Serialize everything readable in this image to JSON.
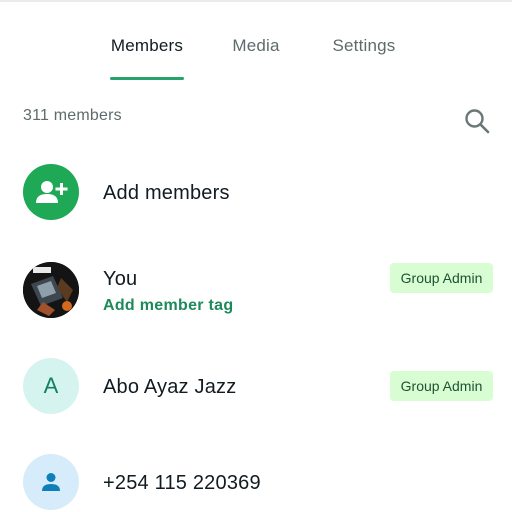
{
  "tabs": [
    {
      "label": "Members",
      "active": true
    },
    {
      "label": "Media",
      "active": false
    },
    {
      "label": "Settings",
      "active": false
    }
  ],
  "members_count": "311 members",
  "search": {
    "icon": "search-icon"
  },
  "add_members": {
    "label": "Add members",
    "icon": "person-add-icon"
  },
  "members": [
    {
      "name": "You",
      "subtitle": "Add member tag",
      "badge": "Group Admin",
      "avatar": "photo"
    },
    {
      "name": "Abo Ayaz Jazz",
      "badge": "Group Admin",
      "avatar_letter": "A"
    },
    {
      "name": "+254 115 220369",
      "avatar": "person-icon"
    }
  ],
  "colors": {
    "accent": "#25a36a",
    "add_avatar_bg": "#1fa855",
    "badge_bg": "#d9fdd3",
    "badge_text": "#1f5132",
    "letter_avatar_bg": "#d5f4f0",
    "person_avatar_bg": "#d6ecfa"
  }
}
